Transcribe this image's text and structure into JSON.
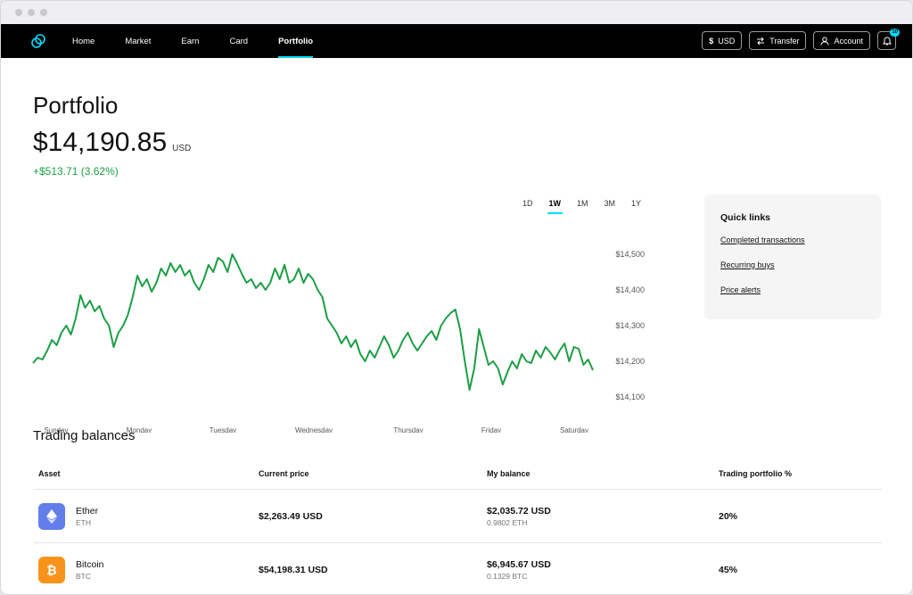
{
  "nav": {
    "items": [
      "Home",
      "Market",
      "Earn",
      "Card",
      "Portfolio"
    ],
    "currency_label": "USD",
    "transfer_label": "Transfer",
    "account_label": "Account",
    "notification_count": "10"
  },
  "portfolio": {
    "title": "Portfolio",
    "balance": "$14,190.85",
    "balance_currency": "USD",
    "change": "+$513.71 (3.62%)"
  },
  "ranges": [
    "1D",
    "1W",
    "1M",
    "3M",
    "1Y"
  ],
  "quick_links": {
    "title": "Quick links",
    "links": [
      "Completed transactions",
      "Recurring buys",
      "Price alerts"
    ]
  },
  "trading": {
    "title": "Trading balances",
    "headers": [
      "Asset",
      "Current price",
      "My balance",
      "Trading portfolio %"
    ],
    "rows": [
      {
        "name": "Ether",
        "symbol": "ETH",
        "price": "$2,263.49 USD",
        "balance": "$2,035.72 USD",
        "amount": "0.9802 ETH",
        "pct": "20%",
        "color": "#627eea"
      },
      {
        "name": "Bitcoin",
        "symbol": "BTC",
        "price": "$54,198.31 USD",
        "balance": "$6,945.67 USD",
        "amount": "0.1329 BTC",
        "pct": "45%",
        "color": "#f7931a"
      }
    ]
  },
  "chart_data": {
    "type": "line",
    "x_labels": [
      "Sunday",
      "Monday",
      "Tuesday",
      "Wednesday",
      "Thursday",
      "Friday",
      "Saturday"
    ],
    "y_tick_labels": [
      "$14,500",
      "$14,400",
      "$14,300",
      "$14,200",
      "$14,100"
    ],
    "y_ticks": [
      14500,
      14400,
      14300,
      14200,
      14100
    ],
    "ylim": [
      14050,
      14550
    ],
    "color": "#1c9e45",
    "values": [
      14195,
      14210,
      14205,
      14230,
      14260,
      14245,
      14280,
      14300,
      14275,
      14320,
      14385,
      14350,
      14370,
      14340,
      14355,
      14320,
      14300,
      14240,
      14280,
      14300,
      14330,
      14380,
      14440,
      14410,
      14430,
      14395,
      14420,
      14460,
      14440,
      14475,
      14450,
      14470,
      14440,
      14455,
      14420,
      14400,
      14430,
      14470,
      14450,
      14490,
      14480,
      14450,
      14500,
      14475,
      14445,
      14420,
      14430,
      14405,
      14420,
      14400,
      14420,
      14460,
      14430,
      14470,
      14420,
      14430,
      14460,
      14420,
      14445,
      14430,
      14400,
      14380,
      14320,
      14300,
      14280,
      14250,
      14270,
      14240,
      14260,
      14220,
      14200,
      14230,
      14210,
      14240,
      14270,
      14245,
      14210,
      14230,
      14260,
      14280,
      14250,
      14230,
      14250,
      14270,
      14285,
      14260,
      14300,
      14320,
      14335,
      14345,
      14290,
      14200,
      14120,
      14180,
      14290,
      14240,
      14190,
      14200,
      14180,
      14135,
      14170,
      14200,
      14180,
      14220,
      14200,
      14195,
      14230,
      14210,
      14240,
      14225,
      14205,
      14230,
      14250,
      14200,
      14240,
      14235,
      14190,
      14205,
      14175
    ]
  }
}
